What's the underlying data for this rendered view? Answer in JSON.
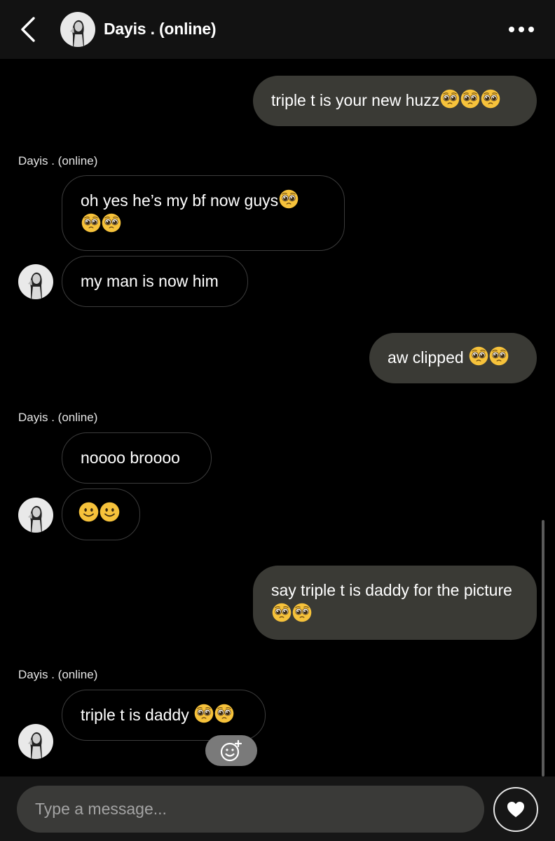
{
  "header": {
    "contact_name": "Dayis . (online)",
    "back_icon": "chevron-left-icon",
    "more_icon": "more-horizontal-icon"
  },
  "messages": [
    {
      "direction": "outgoing",
      "text": "triple t is your new huzz",
      "emoji": [
        "pleading-face",
        "pleading-face",
        "pleading-face"
      ]
    },
    {
      "direction": "incoming",
      "sender": "Dayis . (online)",
      "text": "oh yes he’s my bf now guys",
      "emoji": [
        "pleading-face",
        "pleading-face",
        "pleading-face"
      ]
    },
    {
      "direction": "incoming",
      "text": "my man is now him",
      "emoji": []
    },
    {
      "direction": "outgoing",
      "text": "aw clipped ",
      "emoji": [
        "pleading-face",
        "pleading-face"
      ]
    },
    {
      "direction": "incoming",
      "sender": "Dayis . (online)",
      "text": "noooo broooo",
      "emoji": []
    },
    {
      "direction": "incoming",
      "text": "",
      "emoji": [
        "slightly-smiling-face",
        "slightly-smiling-face"
      ]
    },
    {
      "direction": "outgoing",
      "text": "say triple t is daddy for the picture",
      "emoji": [
        "pleading-face",
        "pleading-face"
      ]
    },
    {
      "direction": "incoming",
      "sender": "Dayis . (online)",
      "text": "triple t is daddy ",
      "emoji": [
        "pleading-face",
        "pleading-face"
      ]
    }
  ],
  "composer": {
    "placeholder": "Type a message...",
    "react_icon": "add-reaction-icon",
    "send_icon": "heart-icon"
  },
  "colors": {
    "background": "#000000",
    "header": "#121212",
    "outgoing_bubble": "#3a3a35",
    "incoming_border": "#3c3c3c",
    "input": "#3a3a38"
  }
}
